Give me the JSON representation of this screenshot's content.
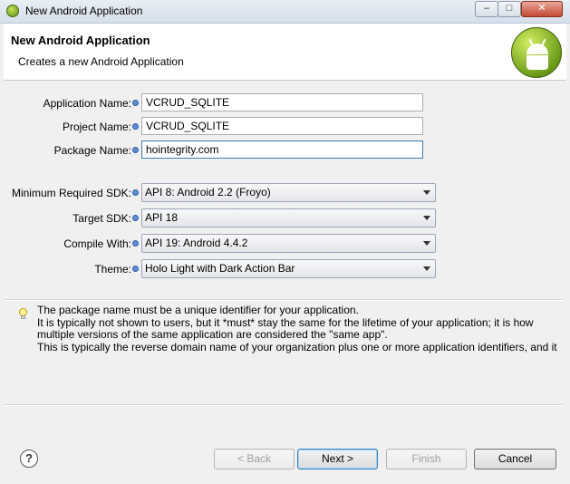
{
  "window": {
    "title": "New Android Application",
    "minimize": "–",
    "maximize": "□",
    "close": "✕"
  },
  "header": {
    "title": "New Android Application",
    "description": "Creates a new Android Application",
    "logo_icon": "android-logo-icon"
  },
  "form": {
    "application_name": {
      "label": "Application Name:",
      "value": "VCRUD_SQLITE"
    },
    "project_name": {
      "label": "Project Name:",
      "value": "VCRUD_SQLITE"
    },
    "package_name": {
      "label": "Package Name:",
      "value": "hointegrity.com"
    },
    "min_sdk": {
      "label": "Minimum Required SDK:",
      "value": "API 8: Android 2.2 (Froyo)"
    },
    "target_sdk": {
      "label": "Target SDK:",
      "value": "API 18"
    },
    "compile_with": {
      "label": "Compile With:",
      "value": "API 19: Android 4.4.2"
    },
    "theme": {
      "label": "Theme:",
      "value": "Holo Light with Dark Action Bar"
    }
  },
  "help": {
    "icon": "lightbulb-icon",
    "lines": [
      "The package name must be a unique identifier for your application.",
      "It is typically not shown to users, but it *must* stay the same for the lifetime of your application; it is how",
      "multiple versions of the same application are considered the \"same app\".",
      "This is typically the reverse domain name of your organization plus one or more application identifiers, and it"
    ]
  },
  "footer": {
    "help_icon": "?",
    "back": "< Back",
    "next": "Next >",
    "finish": "Finish",
    "cancel": "Cancel"
  }
}
